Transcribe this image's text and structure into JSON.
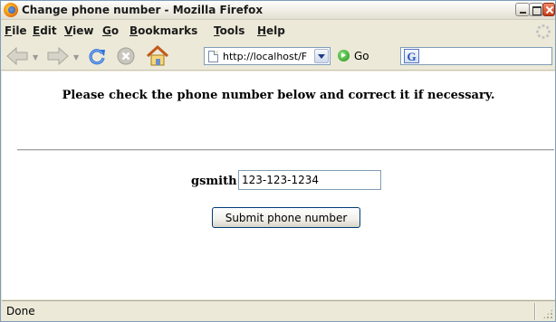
{
  "window": {
    "title": "Change phone number - Mozilla Firefox"
  },
  "menubar": {
    "items": [
      {
        "label": "File",
        "accel": "F",
        "rest": "ile"
      },
      {
        "label": "Edit",
        "accel": "E",
        "rest": "dit"
      },
      {
        "label": "View",
        "accel": "V",
        "rest": "iew"
      },
      {
        "label": "Go",
        "accel": "G",
        "rest": "o"
      },
      {
        "label": "Bookmarks",
        "accel": "B",
        "rest": "ookmarks"
      },
      {
        "label": "Tools",
        "accel": "T",
        "rest": "ools"
      },
      {
        "label": "Help",
        "accel": "H",
        "rest": "elp"
      }
    ]
  },
  "toolbar": {
    "back_icon": "back-arrow-icon",
    "forward_icon": "forward-arrow-icon",
    "reload_icon": "reload-icon",
    "stop_icon": "stop-icon",
    "home_icon": "home-icon",
    "url": "http://localhost/F",
    "go_label": "Go",
    "search_engine_glyph": "G"
  },
  "page": {
    "prompt": "Please check the phone number below and correct it if necessary.",
    "username": "gsmith",
    "phone_value": "123-123-1234",
    "submit_label": "Submit phone number"
  },
  "statusbar": {
    "text": "Done"
  },
  "colors": {
    "chrome_bg": "#ece9d8",
    "content_bg": "#ffffff",
    "border_blue": "#7f9db9"
  }
}
